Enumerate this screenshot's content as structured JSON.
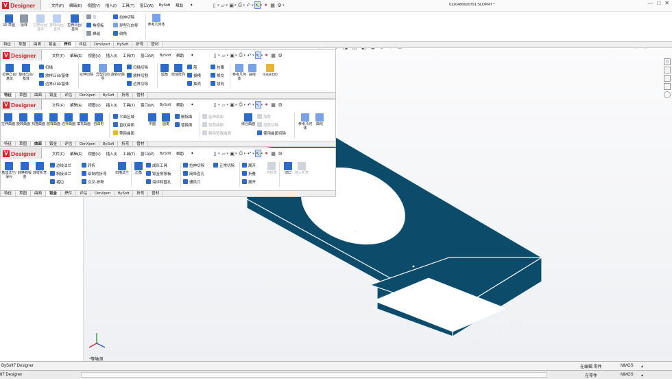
{
  "app": {
    "brand": "Designer",
    "filename": "0120480600791.SLDPRT *"
  },
  "menus": [
    "文件(F)",
    "编辑(E)",
    "视图(V)",
    "插入(I)",
    "工具(T)",
    "窗口(W)",
    "BySoft",
    "帮助"
  ],
  "colors": {
    "model": "#0d4b6b",
    "model_edge": "#e8f0f5",
    "accent": "#d9232a",
    "viewport": "#f6f7f9"
  },
  "pane1": {
    "cmds": [
      {
        "label": "3D 草图",
        "icon": "sketch3d-icon"
      },
      {
        "label": "操样",
        "icon": "sample-icon"
      },
      {
        "label": "拉伸凸台/基体",
        "icon": "extrude-boss-icon"
      },
      {
        "label": "旋转凸台/基体",
        "icon": "revolve-boss-icon"
      },
      {
        "label": "拉伸凸台/基体",
        "icon": "extrude-boss-icon"
      }
    ],
    "rows": [
      "筋",
      "角撑板",
      "焊缝",
      "拉伸切除",
      "异型孔向导",
      "倒角"
    ],
    "ref_label": "参考几何体",
    "tabs": [
      "特征",
      "草图",
      "曲面",
      "钣金",
      "焊件",
      "评估",
      "DimXpert",
      "BySoft",
      "折弯",
      "管材"
    ],
    "active_tab": 4
  },
  "pane2": {
    "cmds": [
      {
        "label": "拉伸凸台/基体"
      },
      {
        "label": "旋转凸台/基体"
      },
      {
        "label": "拉伸切除"
      },
      {
        "label": "异型孔向导"
      },
      {
        "label": "旋转切除"
      },
      {
        "label": "圆角"
      },
      {
        "label": "线性阵列"
      },
      {
        "label": "参考几何体"
      },
      {
        "label": "曲线"
      },
      {
        "label": "Instant3D"
      }
    ],
    "rows": [
      "扫描",
      "放样凸台/基体",
      "边界凸台/基体",
      "扫描切除",
      "放样切割",
      "边界切除",
      "筋",
      "拔模",
      "抽壳",
      "包覆",
      "相交",
      "镜向"
    ],
    "tabs": [
      "特征",
      "草图",
      "曲面",
      "钣金",
      "评估",
      "DimXpert",
      "BySoft",
      "折弯",
      "管材"
    ],
    "active_tab": 0
  },
  "pane3": {
    "cmds": [
      {
        "label": "拉伸曲面"
      },
      {
        "label": "旋转曲面"
      },
      {
        "label": "扫描曲面"
      },
      {
        "label": "放样曲面"
      },
      {
        "label": "边界曲面"
      },
      {
        "label": "填充曲面"
      },
      {
        "label": "自由形"
      },
      {
        "label": "等距曲面"
      },
      {
        "label": "圆角"
      },
      {
        "label": "缝合曲面"
      },
      {
        "label": "参考几何体"
      },
      {
        "label": "曲线"
      }
    ],
    "rows": [
      "平面区域",
      "直纹曲面",
      "中面",
      "删除面",
      "替换面",
      "延伸曲面",
      "剪裁曲面",
      "解除剪裁曲面",
      "加厚",
      "加厚切除",
      "使用曲面切除"
    ],
    "tabs": [
      "特征",
      "草图",
      "曲面",
      "钣金",
      "评估",
      "DimXpert",
      "BySoft",
      "折弯",
      "管材"
    ],
    "active_tab": 2
  },
  "pane4": {
    "cmds": [
      {
        "label": "基体法兰/薄片"
      },
      {
        "label": "转换到钣金"
      },
      {
        "label": "放样折弯"
      },
      {
        "label": "扫描法兰"
      },
      {
        "label": "边角"
      },
      {
        "label": "展开"
      },
      {
        "label": "折叠"
      },
      {
        "label": "不折弯"
      },
      {
        "label": "切口"
      },
      {
        "label": "插入折弯"
      }
    ],
    "rows": [
      "边线法兰",
      "斜接法兰",
      "褶边",
      "转折",
      "绘制的折弯",
      "交叉-折断",
      "成形工具",
      "钣金角撑板",
      "海洋和圆孔",
      "拉伸切除",
      "简单直孔",
      "通风口",
      "正常切除",
      "展开"
    ],
    "tabs": [
      "特征",
      "草图",
      "曲面",
      "钣金",
      "焊件",
      "评估",
      "DimXpert",
      "BySoft",
      "折弯",
      "管材"
    ],
    "active_tab": 3
  },
  "viewport": {
    "view_label": "*等轴测"
  },
  "status": {
    "left_top": "BySoft7 Designer",
    "left_bottom": "ft7 Designer",
    "editing": "在编辑 零件",
    "units": "MMGS",
    "editing2": "在零件",
    "units2": "MMGS"
  }
}
